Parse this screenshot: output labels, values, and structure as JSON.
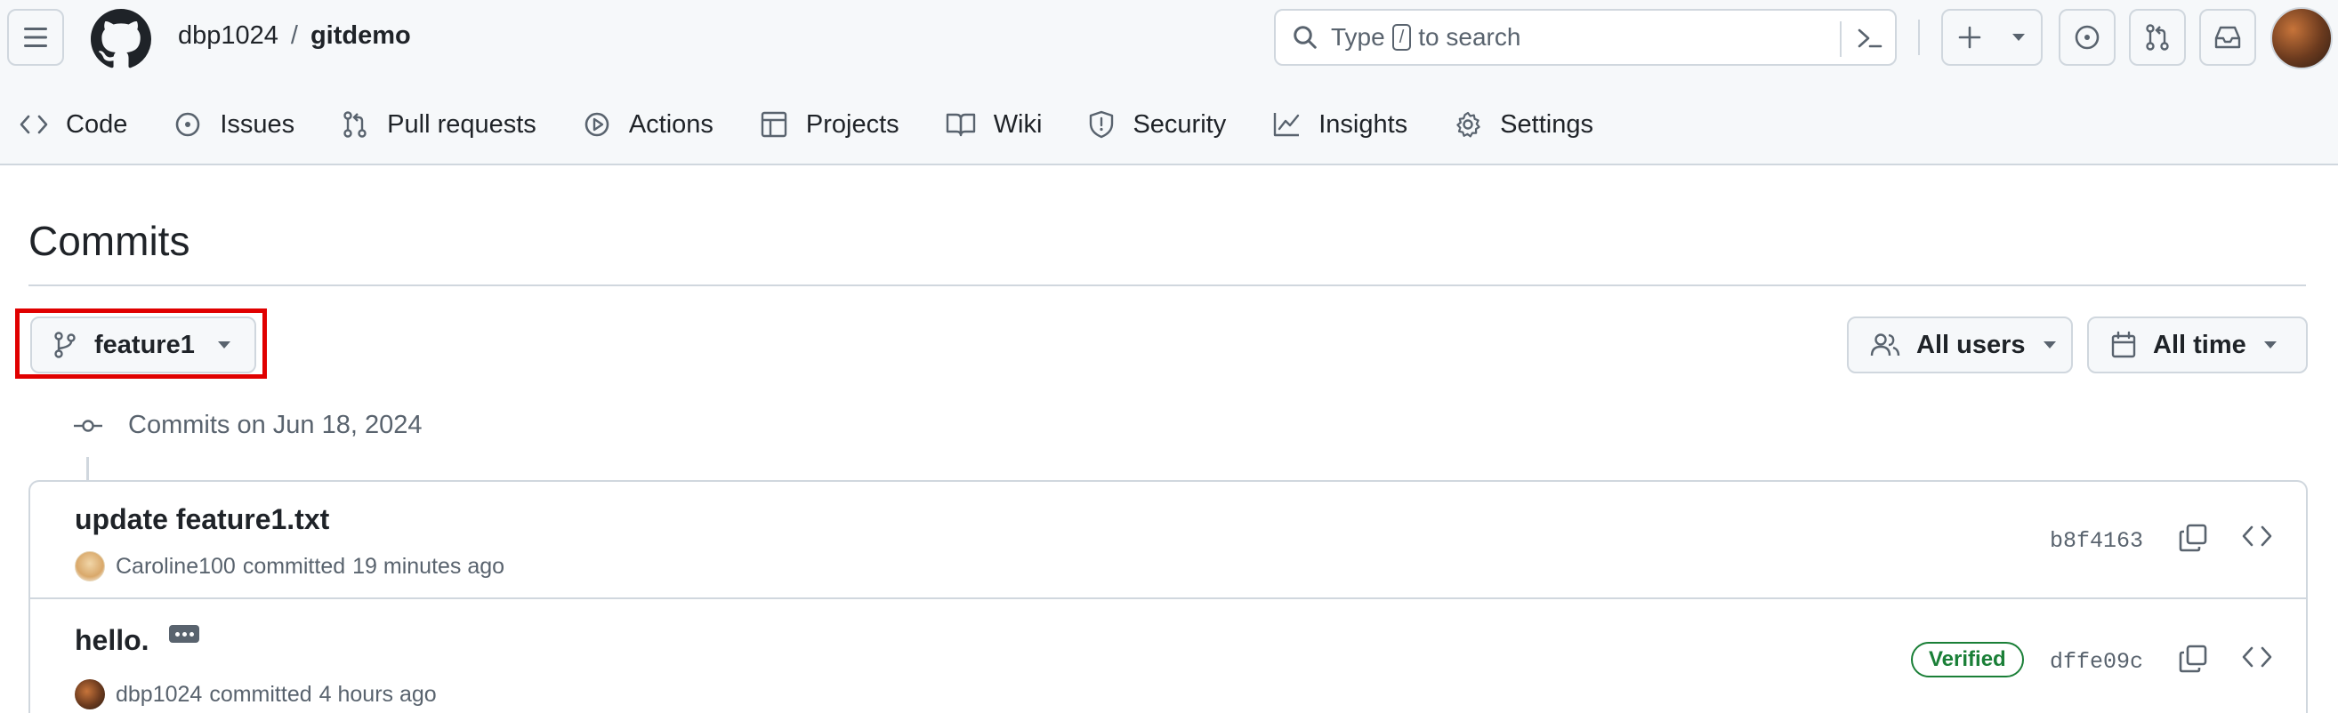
{
  "header": {
    "owner": "dbp1024",
    "separator": "/",
    "repo": "gitdemo",
    "search_placeholder_pre": "Type",
    "search_key": "/",
    "search_placeholder_post": "to search"
  },
  "tabs": [
    {
      "label": "Code",
      "icon": "code-icon"
    },
    {
      "label": "Issues",
      "icon": "issue-opened-icon"
    },
    {
      "label": "Pull requests",
      "icon": "git-pull-request-icon"
    },
    {
      "label": "Actions",
      "icon": "play-icon"
    },
    {
      "label": "Projects",
      "icon": "table-icon"
    },
    {
      "label": "Wiki",
      "icon": "book-icon"
    },
    {
      "label": "Security",
      "icon": "shield-icon"
    },
    {
      "label": "Insights",
      "icon": "graph-icon"
    },
    {
      "label": "Settings",
      "icon": "gear-icon"
    }
  ],
  "page": {
    "title": "Commits",
    "branch": "feature1",
    "users_filter": "All users",
    "time_filter": "All time",
    "group_label": "Commits on Jun 18, 2024"
  },
  "commits": [
    {
      "message": "update feature1.txt",
      "author": "Caroline100",
      "action": "committed",
      "time": "19 minutes ago",
      "sha": "b8f4163",
      "verified": false
    },
    {
      "message": "hello.",
      "author": "dbp1024",
      "action": "committed",
      "time": "4 hours ago",
      "sha": "dffe09c",
      "verified": true,
      "badge": "Verified"
    }
  ],
  "colors": {
    "highlight": "#e00000",
    "verified": "#1a7f37",
    "muted": "#59636e",
    "border": "#d0d7de"
  }
}
